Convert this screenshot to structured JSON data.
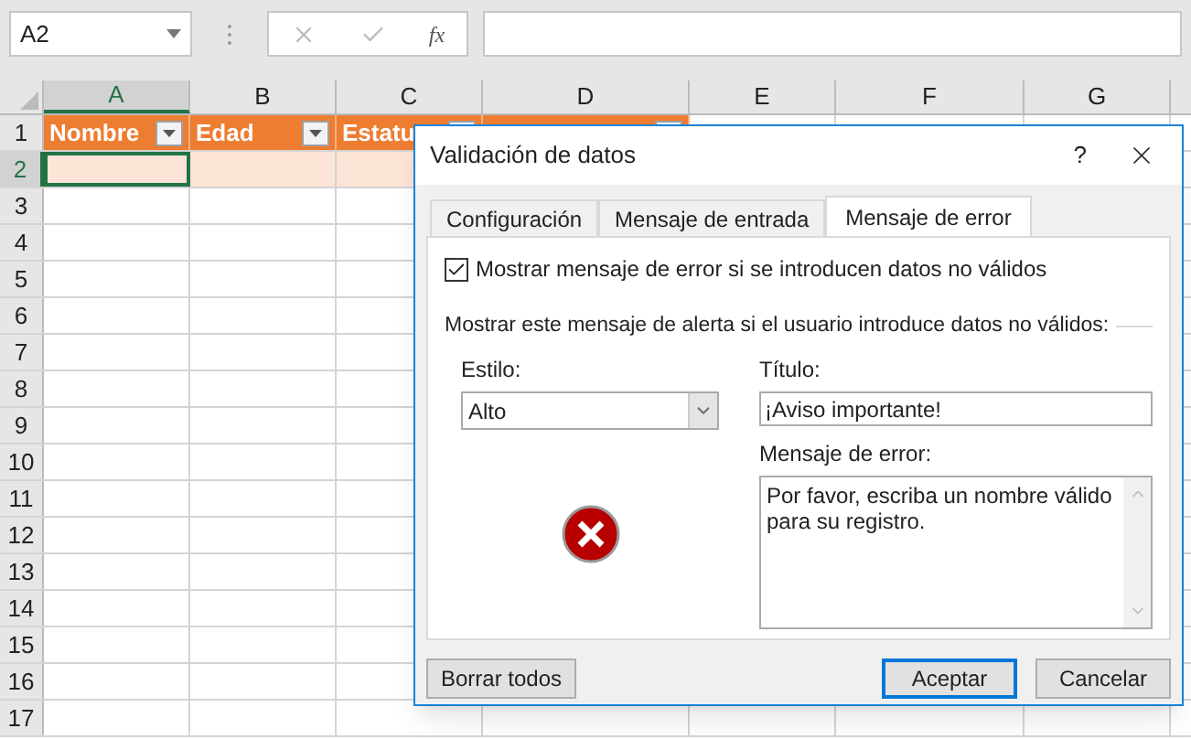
{
  "name_box": {
    "value": "A2"
  },
  "formula_bar": {
    "function_label": "fx"
  },
  "columns": [
    {
      "label": "A",
      "selected": true
    },
    {
      "label": "B",
      "selected": false
    },
    {
      "label": "C",
      "selected": false
    },
    {
      "label": "D",
      "selected": false
    },
    {
      "label": "E",
      "selected": false
    },
    {
      "label": "F",
      "selected": false
    },
    {
      "label": "G",
      "selected": false
    }
  ],
  "rows": [
    {
      "label": "1",
      "selected": false
    },
    {
      "label": "2",
      "selected": true
    },
    {
      "label": "3",
      "selected": false
    },
    {
      "label": "4",
      "selected": false
    },
    {
      "label": "5",
      "selected": false
    },
    {
      "label": "6",
      "selected": false
    },
    {
      "label": "7",
      "selected": false
    },
    {
      "label": "8",
      "selected": false
    },
    {
      "label": "9",
      "selected": false
    },
    {
      "label": "10",
      "selected": false
    },
    {
      "label": "11",
      "selected": false
    },
    {
      "label": "12",
      "selected": false
    },
    {
      "label": "13",
      "selected": false
    },
    {
      "label": "14",
      "selected": false
    },
    {
      "label": "15",
      "selected": false
    },
    {
      "label": "16",
      "selected": false
    },
    {
      "label": "17",
      "selected": false
    }
  ],
  "table": {
    "headers": [
      "Nombre",
      "Edad",
      "Estatu"
    ]
  },
  "dialog": {
    "title": "Validación de datos",
    "help": "?",
    "tabs": [
      {
        "label": "Configuración",
        "selected": false
      },
      {
        "label": "Mensaje de entrada",
        "selected": false
      },
      {
        "label": "Mensaje de error",
        "selected": true
      }
    ],
    "show_error": {
      "label": "Mostrar mensaje de error si se introducen datos no válidos",
      "checked": true
    },
    "section_label": "Mostrar este mensaje de alerta si el usuario introduce datos no válidos:",
    "style_label": "Estilo:",
    "style_value": "Alto",
    "title_label": "Título:",
    "title_value": "¡Aviso importante!",
    "message_label": "Mensaje de error:",
    "message_value": "Por favor, escriba un nombre válido para su registro.",
    "buttons": [
      {
        "label": "Borrar todos",
        "default": false
      },
      {
        "label": "Aceptar",
        "default": true
      },
      {
        "label": "Cancelar",
        "default": false
      }
    ]
  }
}
